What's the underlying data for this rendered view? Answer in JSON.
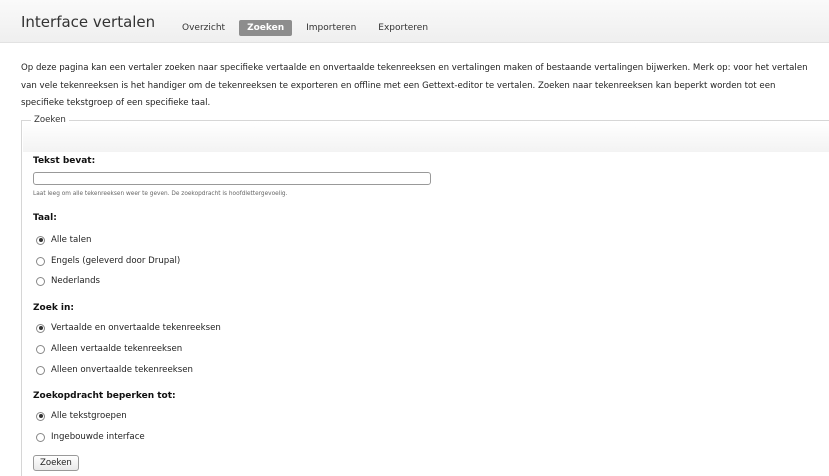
{
  "header": {
    "title": "Interface vertalen",
    "tabs": [
      {
        "label": "Overzicht"
      },
      {
        "label": "Zoeken"
      },
      {
        "label": "Importeren"
      },
      {
        "label": "Exporteren"
      }
    ],
    "active_tab": "Zoeken"
  },
  "intro": "Op deze pagina kan een vertaler zoeken naar specifieke vertaalde en onvertaalde tekenreeksen en vertalingen maken of bestaande vertalingen bijwerken. Merk op: voor het vertalen van vele tekenreeksen is het handiger om de tekenreeksen te exporteren en offline met een Gettext-editor te vertalen. Zoeken naar tekenreeksen kan beperkt worden tot een specifieke tekstgroep of een specifieke taal.",
  "form": {
    "legend": "Zoeken",
    "text": {
      "label": "Tekst bevat:",
      "value": "",
      "description": "Laat leeg om alle tekenreeksen weer te geven. De zoekopdracht is hoofdlettergevoelig."
    },
    "language": {
      "label": "Taal:",
      "options": [
        "Alle talen",
        "Engels (geleverd door Drupal)",
        "Nederlands"
      ],
      "selected": "Alle talen"
    },
    "search_in": {
      "label": "Zoek in:",
      "options": [
        "Vertaalde en onvertaalde tekenreeksen",
        "Alleen vertaalde tekenreeksen",
        "Alleen onvertaalde tekenreeksen"
      ],
      "selected": "Vertaalde en onvertaalde tekenreeksen"
    },
    "group": {
      "label": "Zoekopdracht beperken tot:",
      "options": [
        "Alle tekstgroepen",
        "Ingebouwde interface"
      ],
      "selected": "Alle tekstgroepen"
    },
    "submit_label": "Zoeken"
  }
}
